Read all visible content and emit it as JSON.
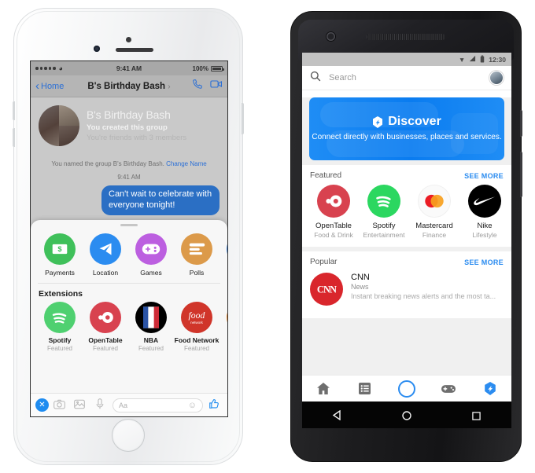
{
  "iphone": {
    "status_bar": {
      "carrier_dots": 5,
      "wifi_icon": "wifi-icon",
      "time": "9:41 AM",
      "battery_percent": "100%"
    },
    "nav": {
      "back_label": "Home",
      "title": "B's Birthday Bash",
      "title_arrow": "›",
      "call_icon": "phone-icon",
      "video_icon": "video-camera-icon"
    },
    "thread": {
      "title": "B's Birthday Bash",
      "subtitle": "You created this group",
      "members": "You're friends with 3 members",
      "system_note": "You named the group B's Birthday Bash.",
      "system_link": "Change Name",
      "timestamp": "9:41 AM",
      "message": "Can't wait to celebrate with everyone tonight!"
    },
    "drawer": {
      "quick": [
        {
          "label": "Payments",
          "icon": "dollar-bill-icon",
          "color": "#3fc05a"
        },
        {
          "label": "Location",
          "icon": "paper-plane-icon",
          "color": "#2b8cf0"
        },
        {
          "label": "Games",
          "icon": "game-controller-icon",
          "color": "#bc5fe0"
        },
        {
          "label": "Polls",
          "icon": "poll-bars-icon",
          "color": "#dc9a4a"
        },
        {
          "label": "",
          "icon": "more-icon",
          "color": "#3b7fd4"
        }
      ],
      "extensions_title": "Extensions",
      "extensions": [
        {
          "name": "Spotify",
          "tag": "Featured",
          "icon": "spotify-icon",
          "color": "#4fd070"
        },
        {
          "name": "OpenTable",
          "tag": "Featured",
          "icon": "opentable-icon",
          "color": "#d8424f"
        },
        {
          "name": "NBA",
          "tag": "Featured",
          "icon": "nba-icon",
          "color": "#000000"
        },
        {
          "name": "Food Network",
          "tag": "Featured",
          "icon": "food-network-icon",
          "color": "#d0352a"
        },
        {
          "name": "",
          "tag": "",
          "icon": "partial-app-icon",
          "color": "#f08b2c"
        }
      ]
    },
    "composer": {
      "close_icon": "close-circle-icon",
      "camera_icon": "camera-icon",
      "photo_icon": "photo-icon",
      "mic_icon": "microphone-icon",
      "placeholder": "Aa",
      "emoji_icon": "smiley-icon",
      "like_icon": "thumbs-up-icon"
    }
  },
  "android": {
    "status_bar": {
      "signal_icon": "signal-triangle-icon",
      "wifi_icon": "wifi-triangle-icon",
      "battery_icon": "battery-icon",
      "time": "12:30"
    },
    "search": {
      "icon": "search-icon",
      "placeholder": "Search",
      "avatar": "profile-avatar"
    },
    "discover": {
      "icon": "discover-hex-icon",
      "title": "Discover",
      "subtitle": "Connect directly with businesses, places and services."
    },
    "featured": {
      "heading": "Featured",
      "see_more": "SEE MORE",
      "items": [
        {
          "name": "OpenTable",
          "category": "Food & Drink",
          "icon": "opentable-icon",
          "color": "#d8424f"
        },
        {
          "name": "Spotify",
          "category": "Entertainment",
          "icon": "spotify-icon",
          "color": "#2bd760"
        },
        {
          "name": "Mastercard",
          "category": "Finance",
          "icon": "mastercard-icon",
          "color": "#fafafa"
        },
        {
          "name": "Nike",
          "category": "Lifestyle",
          "icon": "nike-swoosh-icon",
          "color": "#000000"
        }
      ]
    },
    "popular": {
      "heading": "Popular",
      "see_more": "SEE MORE",
      "items": [
        {
          "name": "CNN",
          "category": "News",
          "description": "Instant breaking news alerts and the most ta...",
          "icon": "cnn-icon",
          "color": "#d9262c"
        }
      ]
    },
    "tabs": [
      {
        "icon": "home-icon",
        "name": "tab-home"
      },
      {
        "icon": "list-icon",
        "name": "tab-list"
      },
      {
        "icon": "camera-ring-icon",
        "name": "tab-camera"
      },
      {
        "icon": "game-controller-icon",
        "name": "tab-games"
      },
      {
        "icon": "discover-hex-icon",
        "name": "tab-discover"
      }
    ],
    "nav_bar": {
      "back": "back-triangle-icon",
      "home": "home-circle-icon",
      "recents": "recents-square-icon"
    }
  }
}
